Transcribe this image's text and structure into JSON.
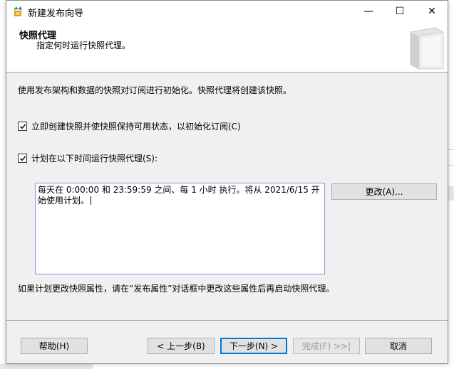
{
  "window": {
    "title": "新建发布向导",
    "icon": "wizard-icon",
    "minimize": "—",
    "maximize": "☐",
    "close": "✕"
  },
  "header": {
    "title": "快照代理",
    "subtitle": "指定何时运行快照代理。"
  },
  "body": {
    "description": "使用发布架构和数据的快照对订阅进行初始化。快照代理将创建该快照。",
    "option_create_now": {
      "label": "立即创建快照并使快照保持可用状态，以初始化订阅(C)",
      "checked": true
    },
    "option_schedule": {
      "label": "计划在以下时间运行快照代理(S):",
      "checked": true
    },
    "schedule_text": "每天在 0:00:00 和 23:59:59 之间、每 1 小时 执行。将从 2021/6/15 开始使用计划。",
    "change_button": "更改(A)...",
    "note": "如果计划更改快照属性，请在“发布属性”对话框中更改这些属性后再启动快照代理。"
  },
  "footer": {
    "help": "帮助(H)",
    "back": "< 上一步(B)",
    "next": "下一步(N) >",
    "finish": "完成(F) >>|",
    "cancel": "取消"
  },
  "colors": {
    "accent": "#0078d7",
    "dialog_bg": "#f0f0f0",
    "check": "#000000"
  }
}
